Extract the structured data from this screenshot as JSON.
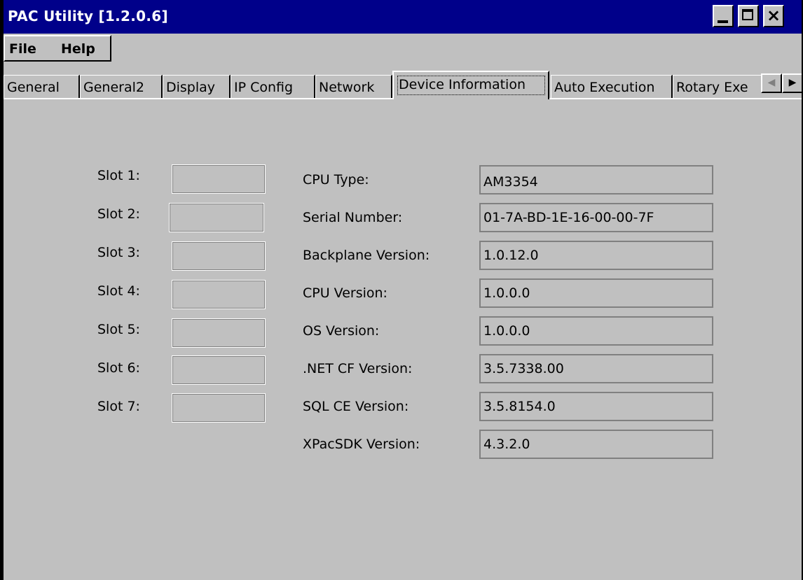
{
  "window": {
    "title": "PAC Utility  [1.2.0.6]",
    "minimize_icon": "minimize-icon",
    "maximize_icon": "maximize-icon",
    "close_icon": "close-icon",
    "close_glyph": "×"
  },
  "menu": {
    "file": "File",
    "help": "Help"
  },
  "tabs": [
    {
      "label": "General"
    },
    {
      "label": "General2"
    },
    {
      "label": "Display"
    },
    {
      "label": "IP Config"
    },
    {
      "label": "Network"
    },
    {
      "label": "Device Information"
    },
    {
      "label": "Auto Execution"
    },
    {
      "label": "Rotary Exe"
    }
  ],
  "active_tab": "Device Information",
  "tab_scroll": {
    "left_icon": "scroll-left-icon",
    "right_icon": "scroll-right-icon",
    "left_glyph": "◀",
    "right_glyph": "▶"
  },
  "slots": [
    {
      "label": "Slot 1:",
      "value": ""
    },
    {
      "label": "Slot 2:",
      "value": ""
    },
    {
      "label": "Slot 3:",
      "value": ""
    },
    {
      "label": "Slot 4:",
      "value": ""
    },
    {
      "label": "Slot 5:",
      "value": ""
    },
    {
      "label": "Slot 6:",
      "value": ""
    },
    {
      "label": "Slot 7:",
      "value": ""
    }
  ],
  "device_info": [
    {
      "label": "CPU  Type:",
      "value": "AM3354"
    },
    {
      "label": "Serial Number:",
      "value": "01-7A-BD-1E-16-00-00-7F"
    },
    {
      "label": "Backplane Version:",
      "value": "1.0.12.0"
    },
    {
      "label": "CPU Version:",
      "value": "1.0.0.0"
    },
    {
      "label": "OS Version:",
      "value": "1.0.0.0"
    },
    {
      "label": ".NET CF Version:",
      "value": "3.5.7338.00"
    },
    {
      "label": "SQL CE Version:",
      "value": "3.5.8154.0"
    },
    {
      "label": "XPacSDK Version:",
      "value": "4.3.2.0"
    }
  ],
  "colors": {
    "title_bar": "#00008a",
    "window_bg": "#c0c0c0"
  }
}
